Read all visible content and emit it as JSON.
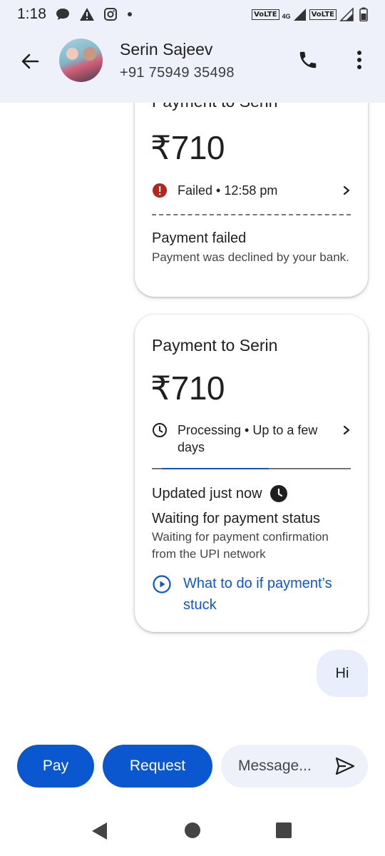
{
  "status_bar": {
    "time": "1:18",
    "network": "4G",
    "volte_1": "VoLTE",
    "volte_2": "VoLTE"
  },
  "header": {
    "contact_name": "Serin Sajeev",
    "contact_phone": "+91 75949 35498"
  },
  "messages": {
    "card_failed": {
      "title": "Payment to Serin",
      "amount": "₹710",
      "status": "Failed • 12:58 pm",
      "heading": "Payment failed",
      "detail": "Payment was declined by your bank.",
      "status_color": "#b3261e"
    },
    "card_processing": {
      "title": "Payment to Serin",
      "amount": "₹710",
      "status": "Processing • Up to a few days",
      "updated": "Updated just now",
      "heading": "Waiting for payment status",
      "detail": "Waiting for payment confirmation from the UPI network",
      "help_link": "What to do if payment’s stuck"
    },
    "text_bubble": "Hi"
  },
  "bottom_bar": {
    "pay_label": "Pay",
    "request_label": "Request",
    "message_placeholder": "Message..."
  },
  "colors": {
    "accent": "#0b57d0",
    "header_bg": "#eef1fa",
    "error": "#b3261e"
  }
}
